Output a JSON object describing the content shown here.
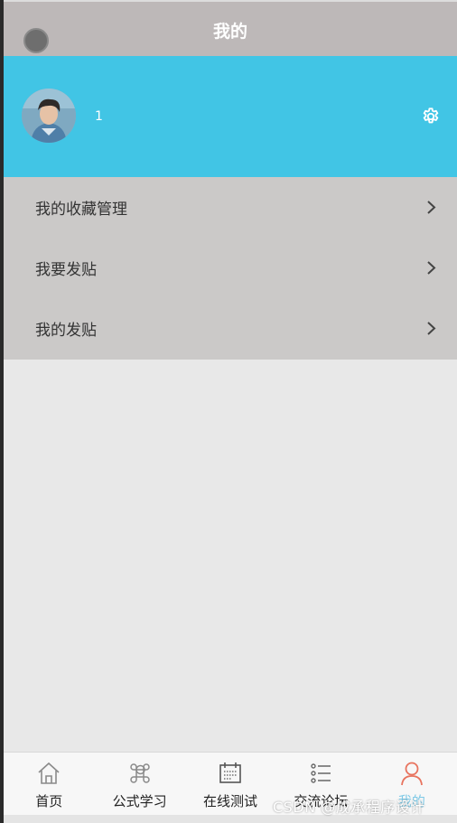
{
  "header": {
    "title": "我的"
  },
  "profile": {
    "username": "1",
    "avatar_icon": "avatar-photo",
    "settings_icon": "gear-icon"
  },
  "menu": {
    "items": [
      {
        "label": "我的收藏管理",
        "icon": "chevron-right-icon"
      },
      {
        "label": "我要发贴",
        "icon": "chevron-right-icon"
      },
      {
        "label": "我的发贴",
        "icon": "chevron-right-icon"
      }
    ]
  },
  "tabbar": {
    "tabs": [
      {
        "label": "首页",
        "icon": "home-icon"
      },
      {
        "label": "公式学习",
        "icon": "command-icon"
      },
      {
        "label": "在线测试",
        "icon": "calendar-icon"
      },
      {
        "label": "交流论坛",
        "icon": "list-icon"
      },
      {
        "label": "我的",
        "icon": "user-icon",
        "active": true
      }
    ]
  },
  "watermark": "CSDN @成承程序设计",
  "colors": {
    "header_bg": "#bdb8b8",
    "profile_bg": "#41c5e5",
    "menu_bg": "#cbc9c8",
    "page_bg": "#e8e8e8",
    "active_tab_icon": "#e8735e",
    "active_tab_label": "#7ec9e6"
  }
}
